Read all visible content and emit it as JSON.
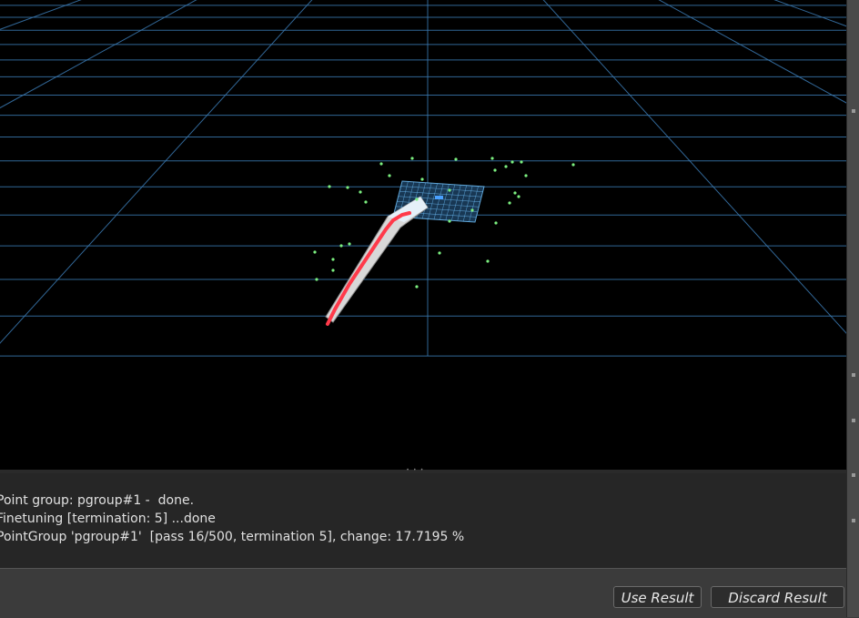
{
  "console": {
    "lines": [
      "Point group: pgroup#1 -  done.",
      "Finetuning [termination: 5] ...done",
      "PointGroup 'pgroup#1'  [pass 16/500, termination 5], change: 17.7195 %"
    ]
  },
  "buttons": {
    "use_result": "Use Result",
    "discard_result": "Discard Result"
  },
  "colors": {
    "grid": "#3a78b0",
    "points": "#7cf080",
    "track": "#ff3a4a",
    "plane": "#6ab8f0",
    "viewport_bg": "#000000"
  }
}
